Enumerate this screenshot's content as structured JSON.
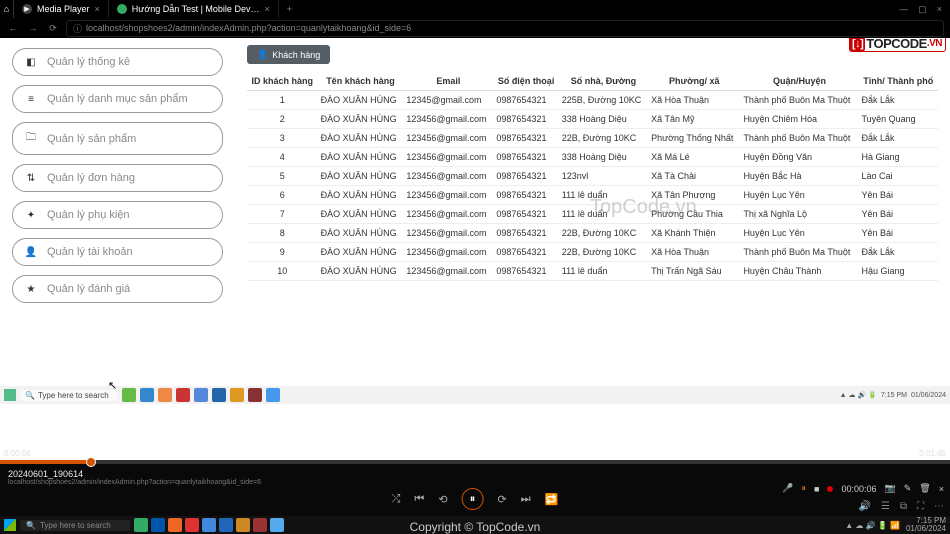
{
  "titlebar": {
    "tab1": "Media Player",
    "tab2": "Hướng Dẫn Test | Mobile Dev…"
  },
  "url": "localhost/shopshoes2/admin/indexAdmin.php?action=quanlytaikhoang&id_side=6",
  "sidebar": {
    "items": [
      {
        "icon": "◧",
        "label": "Quản lý thống kê"
      },
      {
        "icon": "≡",
        "label": "Quản lý danh mục sản phẩm"
      },
      {
        "icon": "🗀",
        "label": "Quản lý sản phẩm"
      },
      {
        "icon": "⇅",
        "label": "Quản lý đơn hàng"
      },
      {
        "icon": "✦",
        "label": "Quản lý phụ kiện"
      },
      {
        "icon": "👤",
        "label": "Quản lý tài khoản"
      },
      {
        "icon": "★",
        "label": "Quản lý đánh giá"
      }
    ]
  },
  "badge": "Khách hàng",
  "table": {
    "headers": [
      "ID khách hàng",
      "Tên khách hàng",
      "Email",
      "Số điện thoại",
      "Số nhà, Đường",
      "Phường/ xã",
      "Quận/Huyện",
      "Tỉnh/ Thành phố"
    ],
    "rows": [
      [
        "1",
        "ĐÀO XUÂN HÙNG",
        "12345@gmail.com",
        "0987654321",
        "225B, Đường 10KC",
        "Xã Hòa Thuận",
        "Thành phố Buôn Ma Thuột",
        "Đắk Lắk"
      ],
      [
        "2",
        "ĐÀO XUÂN HÙNG",
        "123456@gmail.com",
        "0987654321",
        "338 Hoàng Diệu",
        "Xã Tân Mỹ",
        "Huyện Chiêm Hóa",
        "Tuyên Quang"
      ],
      [
        "3",
        "ĐÀO XUÂN HÙNG",
        "123456@gmail.com",
        "0987654321",
        "22B, Đường 10KC",
        "Phường Thống Nhất",
        "Thành phố Buôn Ma Thuột",
        "Đắk Lắk"
      ],
      [
        "4",
        "ĐÀO XUÂN HÙNG",
        "123456@gmail.com",
        "0987654321",
        "338 Hoàng Diệu",
        "Xã Má Lé",
        "Huyện Đồng Văn",
        "Hà Giang"
      ],
      [
        "5",
        "ĐÀO XUÂN HÙNG",
        "123456@gmail.com",
        "0987654321",
        "123nvl",
        "Xã Tà Chải",
        "Huyện Bắc Hà",
        "Lào Cai"
      ],
      [
        "6",
        "ĐÀO XUÂN HÙNG",
        "123456@gmail.com",
        "0987654321",
        "111 lê duẩn",
        "Xã Tân Phượng",
        "Huyện Lục Yên",
        "Yên Bái"
      ],
      [
        "7",
        "ĐÀO XUÂN HÙNG",
        "123456@gmail.com",
        "0987654321",
        "111 lê duẩn",
        "Phường Cầu Thia",
        "Thị xã Nghĩa Lộ",
        "Yên Bái"
      ],
      [
        "8",
        "ĐÀO XUÂN HÙNG",
        "123456@gmail.com",
        "0987654321",
        "22B, Đường 10KC",
        "Xã Khánh Thiện",
        "Huyện Lục Yên",
        "Yên Bái"
      ],
      [
        "9",
        "ĐÀO XUÂN HÙNG",
        "123456@gmail.com",
        "0987654321",
        "22B, Đường 10KC",
        "Xã Hòa Thuận",
        "Thành phố Buôn Ma Thuột",
        "Đắk Lắk"
      ],
      [
        "10",
        "ĐÀO XUÂN HÙNG",
        "123456@gmail.com",
        "0987654321",
        "111 lê duẩn",
        "Thị Trấn Ngã Sáu",
        "Huyện Châu Thành",
        "Hậu Giang"
      ]
    ]
  },
  "watermark": {
    "logo_red": "[↓]",
    "logo_black": "TOPCODE",
    "logo_vn": ".VN",
    "center": "TopCode.vn",
    "copyright": "Copyright © TopCode.vn"
  },
  "player": {
    "elapsed": "0:00:06",
    "total": "0:01:45",
    "title": "20240601_190614",
    "sub": "localhost/shopshoes2/admin/indexAdmin.php?action=quanlytaikhoang&id_side=6",
    "rec_time": "00:00:06"
  },
  "ghost_taskbar": {
    "search": "Type here to search",
    "time": "7:15 PM",
    "date": "01/06/2024"
  },
  "taskbar": {
    "search": "Type here to search",
    "time": "7:15 PM",
    "date": "01/06/2024"
  }
}
